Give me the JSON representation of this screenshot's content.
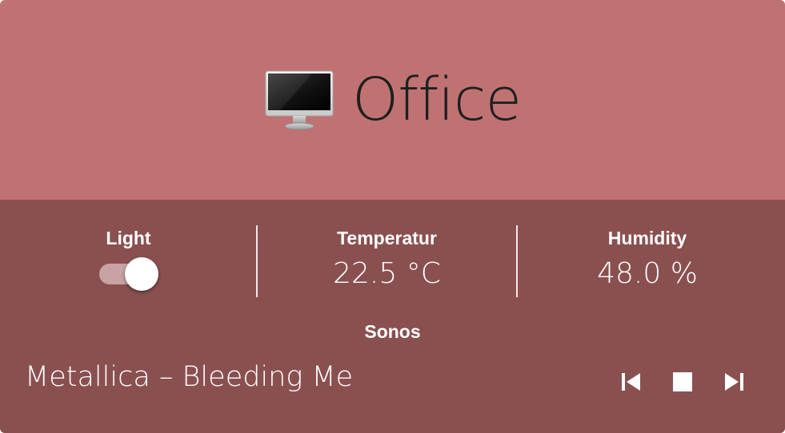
{
  "room": {
    "title": "Office",
    "icon": "desktop-computer-icon"
  },
  "status": {
    "light": {
      "label": "Light",
      "state": "on"
    },
    "temperature": {
      "label": "Temperatur",
      "value": "22.5 °C"
    },
    "humidity": {
      "label": "Humidity",
      "value": "48.0 %"
    }
  },
  "media": {
    "label": "Sonos",
    "now_playing": "Metallica – Bleeding Me",
    "controls": [
      "skip-previous-icon",
      "stop-icon",
      "skip-next-icon"
    ]
  },
  "colors": {
    "header_bg": "#c07272",
    "body_bg": "#8a5050",
    "text_light": "#ffffff",
    "title_text": "#1f1f1f"
  }
}
